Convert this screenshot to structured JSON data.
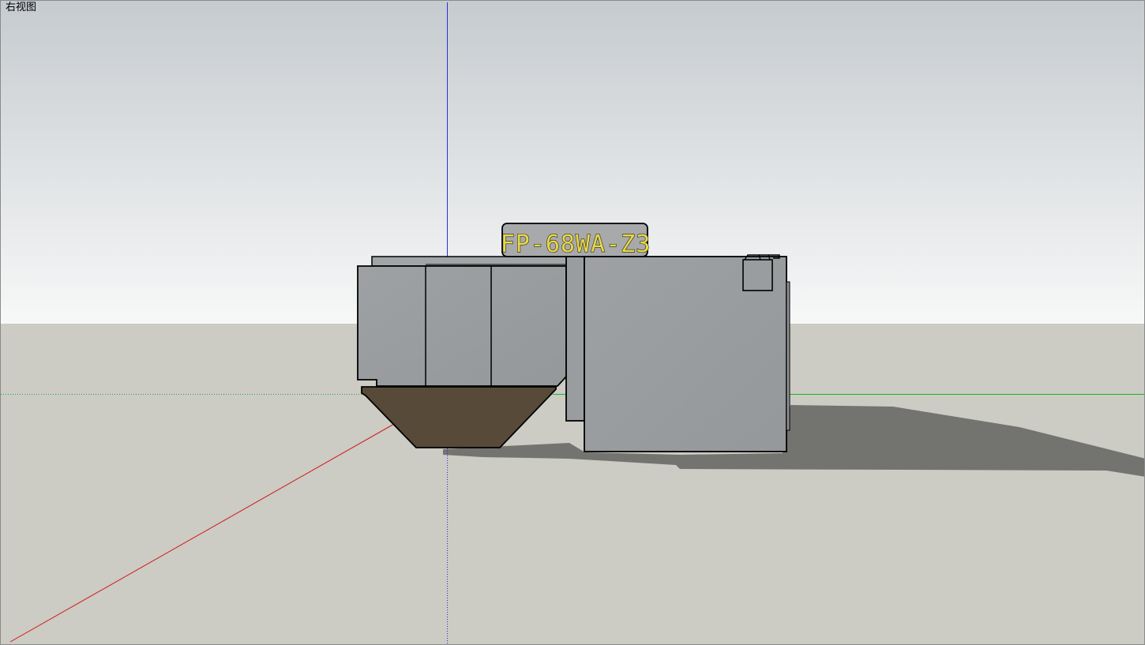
{
  "viewport": {
    "view_name": "右视图"
  },
  "model": {
    "tag_label": "FP-68WA-Z3"
  },
  "colors": {
    "sky_top": "#c7ccd0",
    "sky_bottom": "#f6f7f7",
    "ground": "#cccbc4",
    "shadow": "#737370",
    "body_gray": "#9a9d9f",
    "base_brown": "#574a38",
    "tag_gray": "#a7a9ab",
    "tag_text": "#e8d84a",
    "axis_red": "#d01818",
    "axis_green": "#18b818",
    "axis_blue": "#3030d0"
  }
}
